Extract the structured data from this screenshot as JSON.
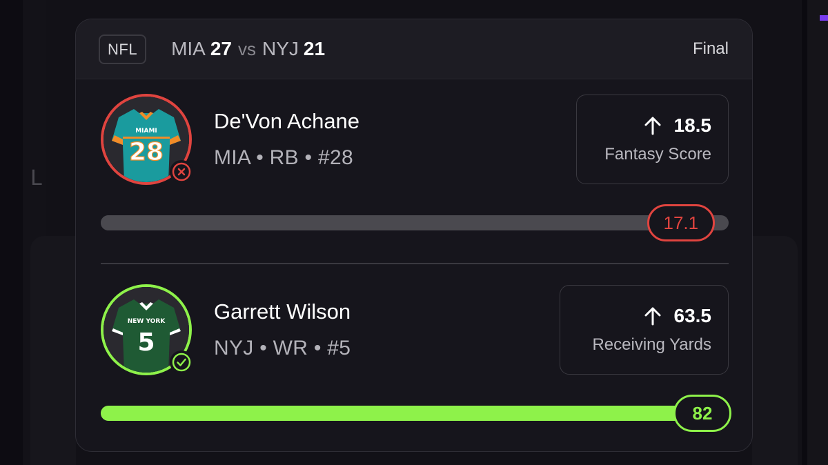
{
  "header": {
    "league": "NFL",
    "home_team": "MIA",
    "home_score": "27",
    "vs_label": "vs",
    "away_team": "NYJ",
    "away_score": "21",
    "status": "Final"
  },
  "background": {
    "partial_letter": "L"
  },
  "players": [
    {
      "name": "De'Von Achane",
      "meta": "MIA • RB • #28",
      "jersey_team_text": "MIAMI",
      "jersey_number": "28",
      "result": "miss",
      "result_icon": "x-icon",
      "result_color": "#e0443f",
      "prop_direction_icon": "arrow-up-icon",
      "prop_line": "18.5",
      "prop_stat": "Fantasy Score",
      "actual_value": "17.1",
      "progress_fraction": 0.924
    },
    {
      "name": "Garrett Wilson",
      "meta": "NYJ • WR • #5",
      "jersey_team_text": "NEW YORK",
      "jersey_number": "5",
      "result": "hit",
      "result_icon": "check-icon",
      "result_color": "#8ef24a",
      "prop_direction_icon": "arrow-up-icon",
      "prop_line": "63.5",
      "prop_stat": "Receiving Yards",
      "actual_value": "82",
      "progress_fraction": 1.0
    }
  ],
  "colors": {
    "miss": "#e0443f",
    "hit": "#8ef24a",
    "card_bg": "#16151c",
    "header_bg": "#1d1c23",
    "track": "#4a494f",
    "miami_jersey": "#1a9b9e",
    "jets_jersey": "#1f5a34"
  }
}
